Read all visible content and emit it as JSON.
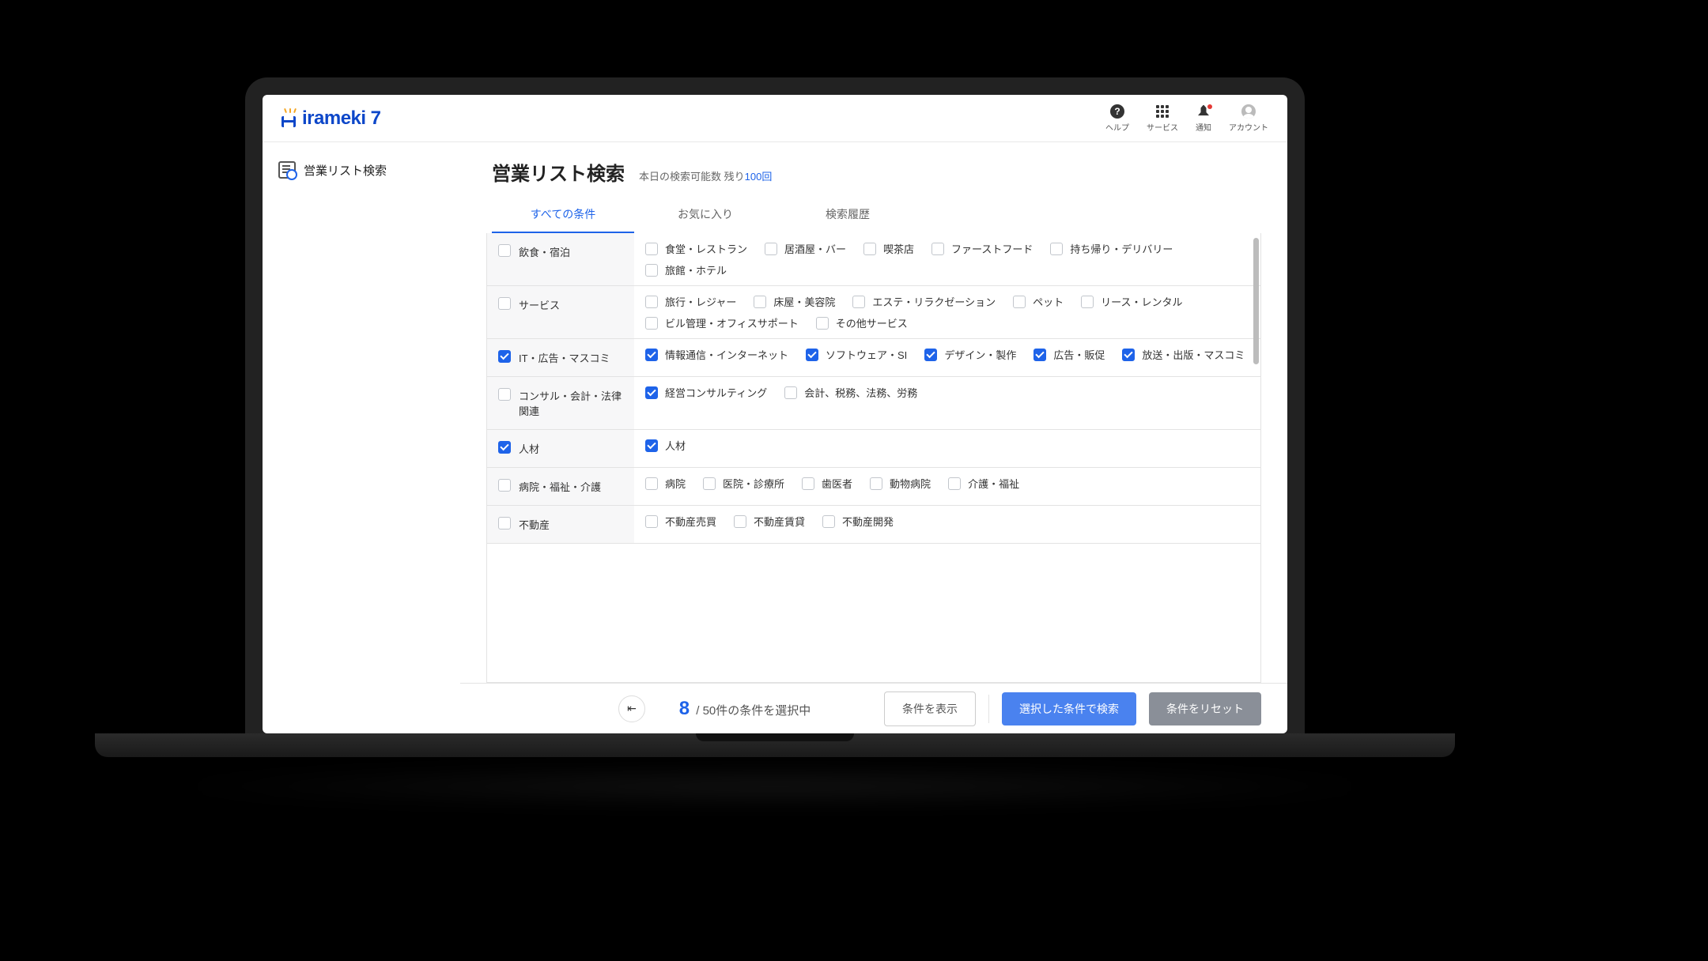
{
  "brand": {
    "name_main": "irameki",
    "name_suffix": "7"
  },
  "header_icons": {
    "help": "ヘルプ",
    "services": "サービス",
    "notifications": "通知",
    "account": "アカウント"
  },
  "sidebar": {
    "search_label": "営業リスト検索"
  },
  "page": {
    "title": "営業リスト検索",
    "quota_prefix": "本日の検索可能数 残り",
    "quota_count": "100回"
  },
  "tabs": {
    "all": "すべての条件",
    "favorites": "お気に入り",
    "history": "検索履歴"
  },
  "categories": [
    {
      "label": "飲食・宿泊",
      "checked": false,
      "children": [
        {
          "label": "食堂・レストラン",
          "checked": false
        },
        {
          "label": "居酒屋・バー",
          "checked": false
        },
        {
          "label": "喫茶店",
          "checked": false
        },
        {
          "label": "ファーストフード",
          "checked": false
        },
        {
          "label": "持ち帰り・デリバリー",
          "checked": false
        },
        {
          "label": "旅館・ホテル",
          "checked": false
        }
      ]
    },
    {
      "label": "サービス",
      "checked": false,
      "children": [
        {
          "label": "旅行・レジャー",
          "checked": false
        },
        {
          "label": "床屋・美容院",
          "checked": false
        },
        {
          "label": "エステ・リラクゼーション",
          "checked": false
        },
        {
          "label": "ペット",
          "checked": false
        },
        {
          "label": "リース・レンタル",
          "checked": false
        },
        {
          "label": "ビル管理・オフィスサポート",
          "checked": false
        },
        {
          "label": "その他サービス",
          "checked": false
        }
      ]
    },
    {
      "label": "IT・広告・マスコミ",
      "checked": true,
      "children": [
        {
          "label": "情報通信・インターネット",
          "checked": true
        },
        {
          "label": "ソフトウェア・SI",
          "checked": true
        },
        {
          "label": "デザイン・製作",
          "checked": true
        },
        {
          "label": "広告・販促",
          "checked": true
        },
        {
          "label": "放送・出版・マスコミ",
          "checked": true
        }
      ]
    },
    {
      "label": "コンサル・会計・法律関連",
      "checked": false,
      "children": [
        {
          "label": "経営コンサルティング",
          "checked": true
        },
        {
          "label": "会計、税務、法務、労務",
          "checked": false
        }
      ]
    },
    {
      "label": "人材",
      "checked": true,
      "children": [
        {
          "label": "人材",
          "checked": true
        }
      ]
    },
    {
      "label": "病院・福祉・介護",
      "checked": false,
      "children": [
        {
          "label": "病院",
          "checked": false
        },
        {
          "label": "医院・診療所",
          "checked": false
        },
        {
          "label": "歯医者",
          "checked": false
        },
        {
          "label": "動物病院",
          "checked": false
        },
        {
          "label": "介護・福祉",
          "checked": false
        }
      ]
    },
    {
      "label": "不動産",
      "checked": false,
      "children": [
        {
          "label": "不動産売買",
          "checked": false
        },
        {
          "label": "不動産賃貸",
          "checked": false
        },
        {
          "label": "不動産開発",
          "checked": false
        }
      ]
    }
  ],
  "bottom_bar": {
    "selected_count": "8",
    "selected_suffix": " / 50件の条件を選択中",
    "show_conditions": "条件を表示",
    "search": "選択した条件で検索",
    "reset": "条件をリセット"
  }
}
